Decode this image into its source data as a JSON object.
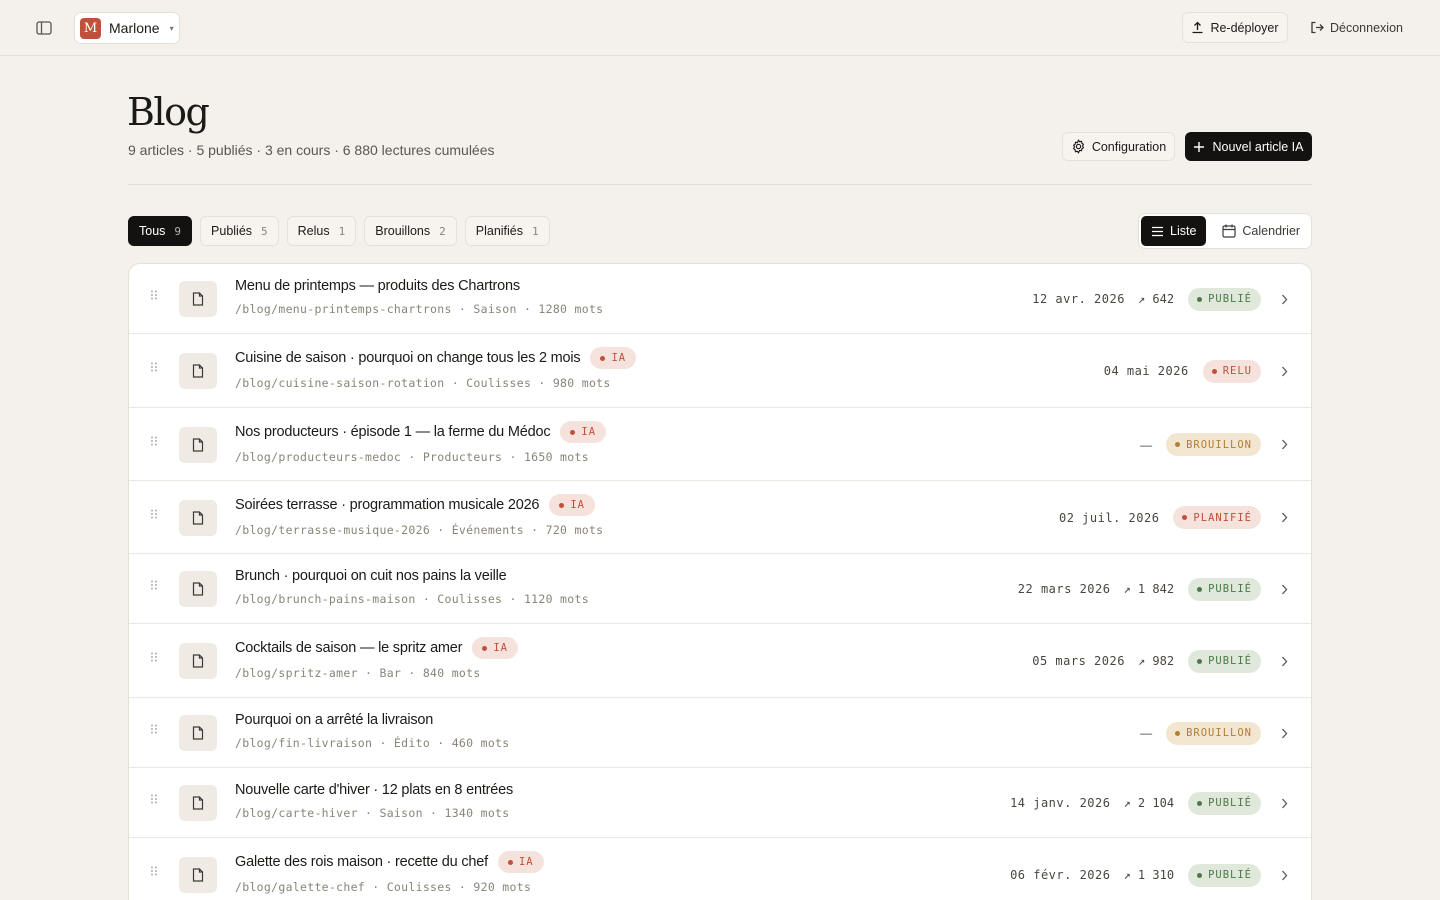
{
  "topbar": {
    "site_initial": "M",
    "site_name": "Marlone",
    "caret": "▾",
    "redeploy_label": "Re-déployer",
    "logout_label": "Déconnexion"
  },
  "header": {
    "title": "Blog",
    "subtitle": "9 articles · 5 publiés · 3 en cours · 6 880 lectures cumulées",
    "config_label": "Configuration",
    "new_article_label": "Nouvel article IA"
  },
  "filters": [
    {
      "label": "Tous",
      "count": "9"
    },
    {
      "label": "Publiés",
      "count": "5"
    },
    {
      "label": "Relus",
      "count": "1"
    },
    {
      "label": "Brouillons",
      "count": "2"
    },
    {
      "label": "Planifiés",
      "count": "1"
    }
  ],
  "active_filter": "Tous",
  "views": {
    "list_label": "Liste",
    "calendar_label": "Calendrier",
    "active": "Liste"
  },
  "colors": {
    "accent": "#c0503c",
    "dark": "#141210",
    "background": "#f4f1ec",
    "publie": "#4b7a4a",
    "brouillon": "#b07e36"
  },
  "articles": [
    {
      "title": "Menu de printemps — produits des Chartrons",
      "ia": false,
      "ia_label": "IA",
      "meta": "/blog/menu-printemps-chartrons · Saison · 1280 mots",
      "date": "12 avr. 2026",
      "views": "↗ 642",
      "status": "PUBLIÉ",
      "status_key": "publie"
    },
    {
      "title": "Cuisine de saison · pourquoi on change tous les 2 mois",
      "ia": true,
      "ia_label": "IA",
      "meta": "/blog/cuisine-saison-rotation · Coulisses · 980 mots",
      "date": "04 mai 2026",
      "views": "",
      "status": "RELU",
      "status_key": "relu"
    },
    {
      "title": "Nos producteurs · épisode 1 — la ferme du Médoc",
      "ia": true,
      "ia_label": "IA",
      "meta": "/blog/producteurs-medoc · Producteurs · 1650 mots",
      "date": "—",
      "views": "",
      "status": "BROUILLON",
      "status_key": "brouillon"
    },
    {
      "title": "Soirées terrasse · programmation musicale 2026",
      "ia": true,
      "ia_label": "IA",
      "meta": "/blog/terrasse-musique-2026 · Événements · 720 mots",
      "date": "02 juil. 2026",
      "views": "",
      "status": "PLANIFIÉ",
      "status_key": "planifie"
    },
    {
      "title": "Brunch · pourquoi on cuit nos pains la veille",
      "ia": false,
      "ia_label": "IA",
      "meta": "/blog/brunch-pains-maison · Coulisses · 1120 mots",
      "date": "22 mars 2026",
      "views": "↗ 1 842",
      "status": "PUBLIÉ",
      "status_key": "publie"
    },
    {
      "title": "Cocktails de saison — le spritz amer",
      "ia": true,
      "ia_label": "IA",
      "meta": "/blog/spritz-amer · Bar · 840 mots",
      "date": "05 mars 2026",
      "views": "↗ 982",
      "status": "PUBLIÉ",
      "status_key": "publie"
    },
    {
      "title": "Pourquoi on a arrêté la livraison",
      "ia": false,
      "ia_label": "IA",
      "meta": "/blog/fin-livraison · Édito · 460 mots",
      "date": "—",
      "views": "",
      "status": "BROUILLON",
      "status_key": "brouillon"
    },
    {
      "title": "Nouvelle carte d'hiver · 12 plats en 8 entrées",
      "ia": false,
      "ia_label": "IA",
      "meta": "/blog/carte-hiver · Saison · 1340 mots",
      "date": "14 janv. 2026",
      "views": "↗ 2 104",
      "status": "PUBLIÉ",
      "status_key": "publie"
    },
    {
      "title": "Galette des rois maison · recette du chef",
      "ia": true,
      "ia_label": "IA",
      "meta": "/blog/galette-chef · Coulisses · 920 mots",
      "date": "06 févr. 2026",
      "views": "↗ 1 310",
      "status": "PUBLIÉ",
      "status_key": "publie"
    }
  ]
}
